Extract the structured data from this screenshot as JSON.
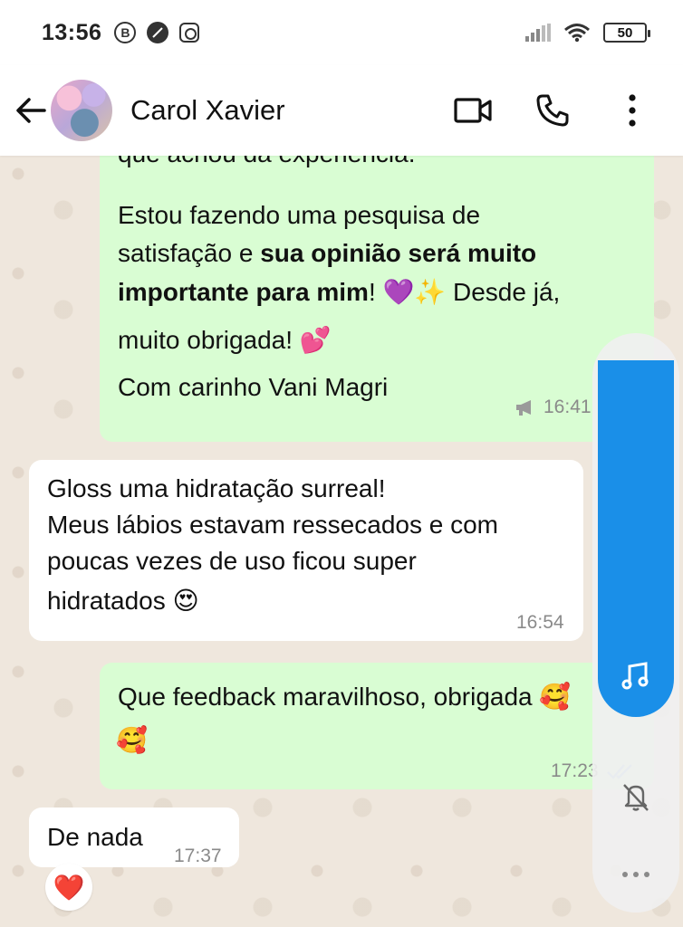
{
  "status_bar": {
    "time": "13:56",
    "b_icon": "B",
    "battery": "50"
  },
  "header": {
    "contact_name": "Carol Xavier"
  },
  "messages": {
    "m1": {
      "line0": "que achou da experiência.",
      "line1": "Estou fazendo uma pesquisa de",
      "line2_a": "satisfação e ",
      "line2_b": "sua opinião será muito",
      "line3_a": "importante para mim",
      "line3_b": "! 💜✨ Desde já,",
      "line4": "muito obrigada! 💕",
      "line5": "Com carinho Vani Magri",
      "time": "16:41"
    },
    "m2": {
      "line1": "Gloss uma hidratação surreal!",
      "line2": "Meus lábios estavam ressecados e com",
      "line3": "poucas vezes de uso ficou super",
      "line4": "hidratados 😍",
      "time": "16:54"
    },
    "m3": {
      "line1": "Que feedback maravilhoso, obrigada 🥰",
      "line2": "🥰",
      "time": "17:23"
    },
    "m4": {
      "text": "De nada",
      "time": "17:37",
      "reaction": "❤️"
    }
  },
  "colors": {
    "outgoing_bubble": "#d9fdd3",
    "incoming_bubble": "#ffffff",
    "chat_background": "#efe7dd",
    "overlay_blue": "#1a8fe8",
    "read_ticks": "#8fb7e8"
  },
  "icons": {
    "back": "arrow-left-icon",
    "video": "video-camera-icon",
    "call": "phone-icon",
    "menu": "more-vertical-icon",
    "music": "music-note-icon",
    "mute": "bell-off-icon",
    "more": "more-horizontal-icon"
  }
}
